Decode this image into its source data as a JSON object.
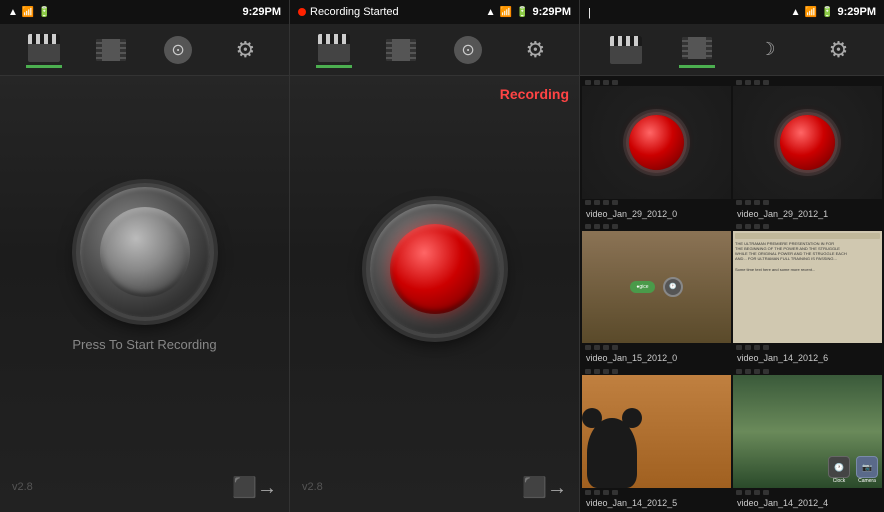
{
  "panels": {
    "left": {
      "statusBar": {
        "time": "9:29PM",
        "icons": [
          "wifi",
          "signal",
          "battery"
        ]
      },
      "toolbar": {
        "icons": [
          "clapperboard",
          "filmstrip",
          "speedometer",
          "gear"
        ]
      },
      "recordButton": {
        "state": "idle",
        "label": "Press To Start Recording"
      },
      "footer": {
        "version": "v2.8",
        "exitLabel": "exit"
      }
    },
    "middle": {
      "statusBar": {
        "recDot": true,
        "recText": "Recording Started",
        "time": "9:29PM",
        "icons": [
          "wifi",
          "signal",
          "battery"
        ]
      },
      "toolbar": {
        "icons": [
          "clapperboard",
          "filmstrip",
          "speedometer",
          "gear"
        ]
      },
      "recordButton": {
        "state": "active",
        "recordingLabel": "Recording"
      },
      "footer": {
        "version": "v2.8",
        "exitLabel": "exit"
      }
    },
    "right": {
      "statusBar": {
        "time": "9:29PM",
        "icons": [
          "wifi",
          "signal",
          "battery"
        ]
      },
      "toolbar": {
        "icons": [
          "clapperboard",
          "filmstrip",
          "speedometer",
          "gear"
        ]
      },
      "videoGrid": [
        {
          "label": "video_Jan_29_2012_0",
          "thumb": "red-btn"
        },
        {
          "label": "video_Jan_29_2012_1",
          "thumb": "red-btn"
        },
        {
          "label": "video_Jan_15_2012_0",
          "thumb": "landscape-app"
        },
        {
          "label": "video_Jan_14_2012_6",
          "thumb": "browser"
        },
        {
          "label": "video_Jan_14_2012_5",
          "thumb": "cartoon"
        },
        {
          "label": "video_Jan_14_2012_4",
          "thumb": "nature"
        }
      ]
    }
  }
}
